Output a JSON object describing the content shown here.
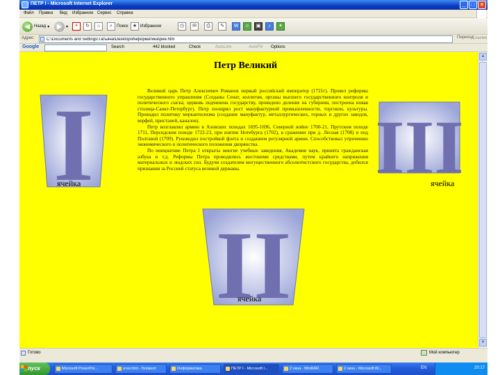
{
  "window": {
    "title": "ПЕТР I - Microsoft Internet Explorer"
  },
  "menu": [
    "Файл",
    "Правка",
    "Вид",
    "Избранное",
    "Сервис",
    "Справка"
  ],
  "toolbar": {
    "back_label": "Назад",
    "search_label": "Поиск",
    "favorites_label": "Избранное"
  },
  "address": {
    "label": "Адрес:",
    "value": "C:\\Documents and Settings\\Татьяна\\Desktop\\Информатика\\рие.htm",
    "go_label": "Переход",
    "links_label": "Ссылки"
  },
  "googlebar": {
    "logo": "Google",
    "search_label": "Search",
    "blocked_label": "442 blocked",
    "check_label": "Check",
    "autolink_label": "AutoLink",
    "autofill_label": "AutoFill",
    "options_label": "Options"
  },
  "page": {
    "title": "Петр Великий",
    "paragraphs": [
      "Великий царь Петр Алексеевич Романов первый российский император (1721г). Провел реформы государственного управления (Созданы Сенат, коллегии, органы высшего государственного контроля и политического сыска; церковь подчинена государству, проведено деление на губернии, построена новая столица-Санкт-Петербург). Петр поощрял рост мануфактурной промышленности, торговли, культуры. Проводил политику меркантилизма (создание мануфактур, металлургических, горных и других заводов, верфей, пристаней, каналов).",
      "Петр возглавлял армию в Азовских походах 1695-1696, Северной войне 1700-21, Прутском походе 1711, Персидском походе 1722-23, при взятии Нотебурга (1702), в сражении при д. Лесная (1708) и под Полтавой (1709). Руководил постройкой флота и созданием регулярной армии. Способствовал упрочению экономического и политического положения дворянства.",
      "По инициативе Петра I открыты многие учебные заведения, Академия наук, принята гражданская азбука и т.д. Реформы Петра проводились жестокими средствами, путем крайнего напряжения материальных и людских сил. Будучи создателем могущественного абсолютистского государства, добился признания за Россией статуса великой державы."
    ]
  },
  "cells": [
    {
      "numeral": "I",
      "label": "ячейка"
    },
    {
      "numeral": "II",
      "label": "ячейка"
    },
    {
      "numeral": "III",
      "label": "ячейка"
    }
  ],
  "colors": {
    "page_background": "#ffff00",
    "numeral_fill": "#7070b0",
    "cell_background": "#c0c8e8"
  },
  "statusbar": {
    "text": "Готово",
    "zone": "Мой компьютер"
  },
  "taskbar": {
    "start_label": "пуск",
    "tasks": [
      {
        "label": "Microsoft PowerPoi..."
      },
      {
        "label": "атно.htm - Блокнот"
      },
      {
        "label": "Информатика"
      },
      {
        "label": "ПЕТР I - Microsoft I..."
      },
      {
        "label": "2 окна - WinRAR"
      },
      {
        "label": "2 окон - Microsoft W..."
      }
    ],
    "language": "EN",
    "clock": "20:17"
  }
}
